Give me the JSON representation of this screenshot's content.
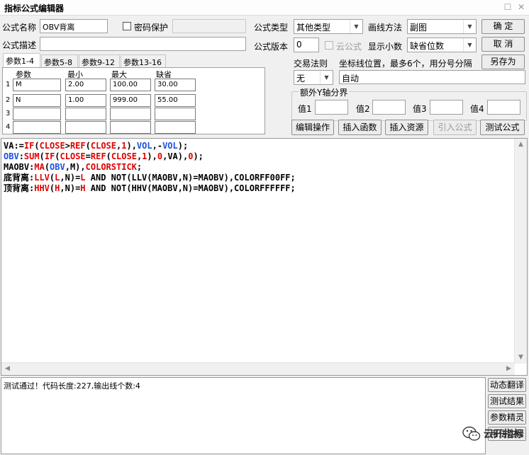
{
  "window": {
    "title": "指标公式编辑器",
    "restore_glyph": "☐",
    "close_glyph": "✕"
  },
  "form": {
    "name_label": "公式名称",
    "name_value": "OBV背离",
    "password_label": "密码保护",
    "password_value": "",
    "desc_label": "公式描述",
    "desc_value": "",
    "type_label": "公式类型",
    "type_value": "其他类型",
    "draw_label": "画线方法",
    "draw_value": "副图",
    "version_label": "公式版本",
    "version_value": "0",
    "cloud_label": "云公式",
    "decimals_label": "显示小数",
    "decimals_value": "缺省位数"
  },
  "buttons": {
    "ok": "确  定",
    "cancel": "取  消",
    "save_as": "另存为",
    "edit_ops": "编辑操作",
    "insert_func": "插入函数",
    "insert_res": "插入资源",
    "import_formula": "引入公式",
    "test_formula": "测试公式"
  },
  "tabs": [
    "参数1-4",
    "参数5-8",
    "参数9-12",
    "参数13-16"
  ],
  "params": {
    "headers": [
      "参数",
      "最小",
      "最大",
      "缺省"
    ],
    "rows": [
      {
        "num": "1",
        "name": "M",
        "min": "2.00",
        "max": "100.00",
        "def": "30.00"
      },
      {
        "num": "2",
        "name": "N",
        "min": "1.00",
        "max": "999.00",
        "def": "55.00"
      },
      {
        "num": "3",
        "name": "",
        "min": "",
        "max": "",
        "def": ""
      },
      {
        "num": "4",
        "name": "",
        "min": "",
        "max": "",
        "def": ""
      }
    ]
  },
  "trade": {
    "rule_label": "交易法则",
    "rule_value": "无",
    "axis_label": "坐标线位置，最多6个，用分号分隔",
    "axis_value": "自动",
    "extra_label": "额外Y轴分界",
    "val_labels": [
      "值1",
      "值2",
      "值3",
      "值4"
    ]
  },
  "code": [
    [
      {
        "t": "VA:=",
        "c": "black"
      },
      {
        "t": "IF",
        "c": "red"
      },
      {
        "t": "(",
        "c": "black"
      },
      {
        "t": "CLOSE",
        "c": "red"
      },
      {
        "t": ">",
        "c": "black"
      },
      {
        "t": "REF",
        "c": "red"
      },
      {
        "t": "(",
        "c": "black"
      },
      {
        "t": "CLOSE",
        "c": "red"
      },
      {
        "t": ",",
        "c": "black"
      },
      {
        "t": "1",
        "c": "red"
      },
      {
        "t": "),",
        "c": "black"
      },
      {
        "t": "VOL",
        "c": "blue"
      },
      {
        "t": ",-",
        "c": "black"
      },
      {
        "t": "VOL",
        "c": "blue"
      },
      {
        "t": ");",
        "c": "black"
      }
    ],
    [
      {
        "t": "OBV",
        "c": "blue"
      },
      {
        "t": ":",
        "c": "black"
      },
      {
        "t": "SUM",
        "c": "red"
      },
      {
        "t": "(",
        "c": "black"
      },
      {
        "t": "IF",
        "c": "red"
      },
      {
        "t": "(",
        "c": "black"
      },
      {
        "t": "CLOSE",
        "c": "red"
      },
      {
        "t": "=",
        "c": "black"
      },
      {
        "t": "REF",
        "c": "red"
      },
      {
        "t": "(",
        "c": "black"
      },
      {
        "t": "CLOSE",
        "c": "red"
      },
      {
        "t": ",",
        "c": "black"
      },
      {
        "t": "1",
        "c": "red"
      },
      {
        "t": "),",
        "c": "black"
      },
      {
        "t": "0",
        "c": "red"
      },
      {
        "t": ",VA),",
        "c": "black"
      },
      {
        "t": "0",
        "c": "red"
      },
      {
        "t": ");",
        "c": "black"
      }
    ],
    [
      {
        "t": "MAOBV:",
        "c": "black"
      },
      {
        "t": "MA",
        "c": "red"
      },
      {
        "t": "(",
        "c": "black"
      },
      {
        "t": "OBV",
        "c": "blue"
      },
      {
        "t": ",M),",
        "c": "black"
      },
      {
        "t": "COLORSTICK",
        "c": "red"
      },
      {
        "t": ";",
        "c": "black"
      }
    ],
    [
      {
        "t": "底背离:",
        "c": "black"
      },
      {
        "t": "LLV",
        "c": "red"
      },
      {
        "t": "(",
        "c": "black"
      },
      {
        "t": "L",
        "c": "red"
      },
      {
        "t": ",N)=",
        "c": "black"
      },
      {
        "t": "L",
        "c": "red"
      },
      {
        "t": " AND NOT(LLV(MAOBV,N)=MAOBV),COLORFF00FF;",
        "c": "black"
      }
    ],
    [
      {
        "t": "顶背离:",
        "c": "black"
      },
      {
        "t": "HHV",
        "c": "red"
      },
      {
        "t": "(",
        "c": "black"
      },
      {
        "t": "H",
        "c": "red"
      },
      {
        "t": ",N)=",
        "c": "black"
      },
      {
        "t": "H",
        "c": "red"
      },
      {
        "t": " AND NOT(HHV(MAOBV,N)=MAOBV),COLORFFFFFF;",
        "c": "black"
      }
    ]
  ],
  "output": {
    "message": "测试通过！代码长度:227,输出线个数:4"
  },
  "side": {
    "dynamic_translate": "动态翻译",
    "test_results": "测试结果",
    "param_wizard": "参数精灵",
    "usage_notes": "用法注释"
  },
  "watermark": {
    "text": "云开指标"
  },
  "colors": {
    "function": "#e00000",
    "variable": "#1a4fe0"
  }
}
